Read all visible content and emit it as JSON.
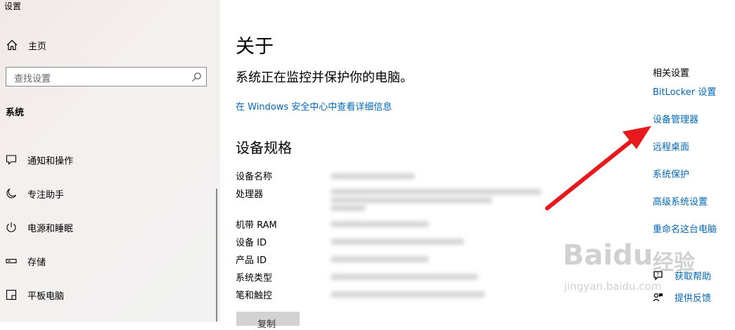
{
  "window": {
    "title": "设置"
  },
  "sidebar": {
    "home_label": "主页",
    "search_placeholder": "查找设置",
    "section_label": "系统",
    "items": [
      {
        "label": "通知和操作",
        "icon": "notification-icon"
      },
      {
        "label": "专注助手",
        "icon": "moon-icon"
      },
      {
        "label": "电源和睡眠",
        "icon": "power-icon"
      },
      {
        "label": "存储",
        "icon": "storage-icon"
      },
      {
        "label": "平板电脑",
        "icon": "tablet-icon"
      }
    ]
  },
  "main": {
    "title": "关于",
    "protect_text": "系统正在监控并保护你的电脑。",
    "security_link": "在 Windows 安全中心中查看详细信息",
    "specs_title": "设备规格",
    "specs": [
      {
        "label": "设备名称"
      },
      {
        "label": "处理器"
      },
      {
        "label": "机带 RAM"
      },
      {
        "label": "设备 ID"
      },
      {
        "label": "产品 ID"
      },
      {
        "label": "系统类型"
      },
      {
        "label": "笔和触控"
      }
    ],
    "copy_label": "复制"
  },
  "related": {
    "title": "相关设置",
    "links": [
      "BitLocker 设置",
      "设备管理器",
      "远程桌面",
      "系统保护",
      "高级系统设置",
      "重命名这台电脑"
    ]
  },
  "help": {
    "get_help": "获取帮助",
    "feedback": "提供反馈"
  },
  "annotation": {
    "arrow_color": "#e8191c"
  },
  "watermark": {
    "brand": "Baidu",
    "brand_cn": "经验",
    "url": "jingyan.baidu.com"
  },
  "colors": {
    "link": "#0067b8",
    "sidebar_bg": "#f2f2f2"
  }
}
